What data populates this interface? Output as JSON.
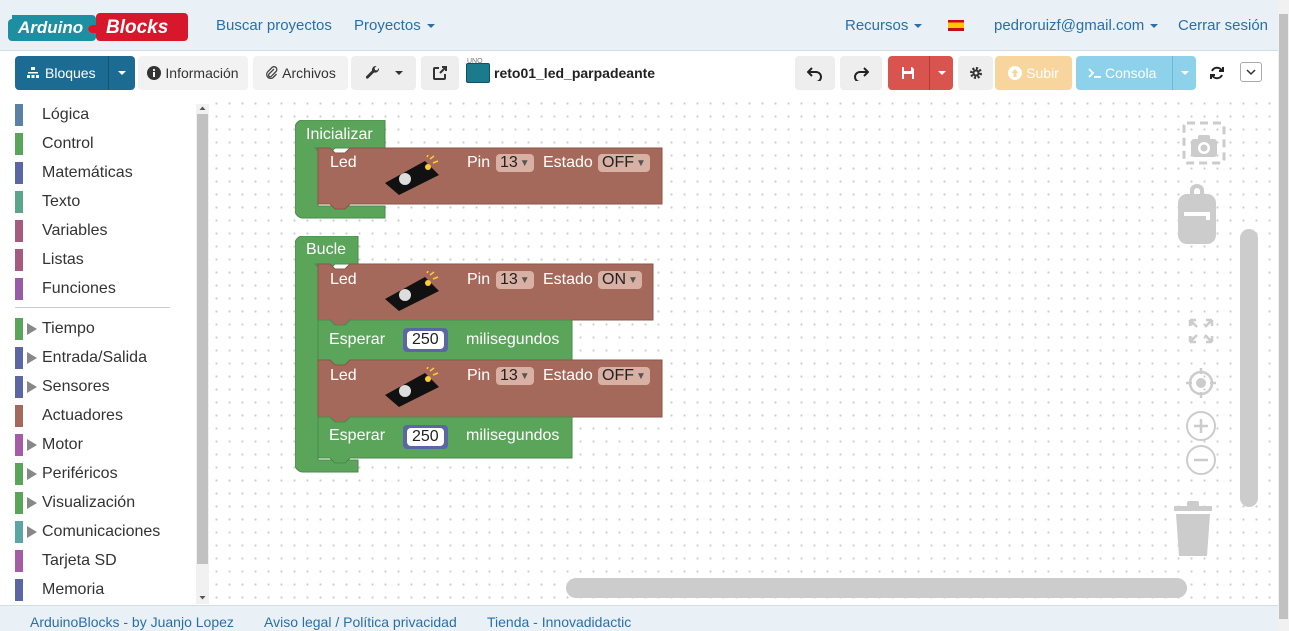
{
  "navbar": {
    "logo_text_1": "Arduino",
    "logo_text_2": "Blocks",
    "links": [
      "Buscar proyectos",
      "Proyectos",
      "Recursos",
      "pedroruizf@gmail.com",
      "Cerrar sesión"
    ]
  },
  "toolbar": {
    "bloques": "Bloques",
    "informacion": "Información",
    "archivos": "Archivos",
    "board_label": "UNO",
    "project_name": "reto01_led_parpadeante",
    "subir": "Subir",
    "consola": "Consola"
  },
  "toolbox": {
    "items": [
      {
        "label": "Lógica",
        "color": "#5b80a5",
        "expandable": false
      },
      {
        "label": "Control",
        "color": "#5ba55b",
        "expandable": false
      },
      {
        "label": "Matemáticas",
        "color": "#5b67a5",
        "expandable": false
      },
      {
        "label": "Texto",
        "color": "#5ba58c",
        "expandable": false
      },
      {
        "label": "Variables",
        "color": "#a55b80",
        "expandable": false
      },
      {
        "label": "Listas",
        "color": "#a55b80",
        "expandable": false
      },
      {
        "label": "Funciones",
        "color": "#995ba5",
        "expandable": false
      },
      {
        "label": "Tiempo",
        "color": "#5ba55b",
        "expandable": true
      },
      {
        "label": "Entrada/Salida",
        "color": "#5b67a5",
        "expandable": true
      },
      {
        "label": "Sensores",
        "color": "#5b67a5",
        "expandable": true
      },
      {
        "label": "Actuadores",
        "color": "#a5695b",
        "expandable": false
      },
      {
        "label": "Motor",
        "color": "#a55ba5",
        "expandable": true
      },
      {
        "label": "Periféricos",
        "color": "#5ba55b",
        "expandable": true
      },
      {
        "label": "Visualización",
        "color": "#5ba55b",
        "expandable": true
      },
      {
        "label": "Comunicaciones",
        "color": "#5ba5a5",
        "expandable": true
      },
      {
        "label": "Tarjeta SD",
        "color": "#a55ba5",
        "expandable": false
      },
      {
        "label": "Memoria",
        "color": "#5b67a5",
        "expandable": false
      }
    ]
  },
  "blocks": {
    "init_label": "Inicializar",
    "loop_label": "Bucle",
    "led_label": "Led",
    "pin_label": "Pin",
    "estado_label": "Estado",
    "esperar_label": "Esperar",
    "ms_label": "milisegundos",
    "init_led": {
      "pin": "13",
      "estado": "OFF"
    },
    "loop_led_1": {
      "pin": "13",
      "estado": "ON"
    },
    "loop_wait_1": "250",
    "loop_led_2": {
      "pin": "13",
      "estado": "OFF"
    },
    "loop_wait_2": "250",
    "colors": {
      "control": "#5ba55b",
      "actuator": "#a5695b",
      "math": "#5b67a5"
    }
  },
  "footer": {
    "links": [
      "ArduinoBlocks - by Juanjo Lopez",
      "Aviso legal / Política privacidad",
      "Tienda - Innovadidactic"
    ]
  }
}
